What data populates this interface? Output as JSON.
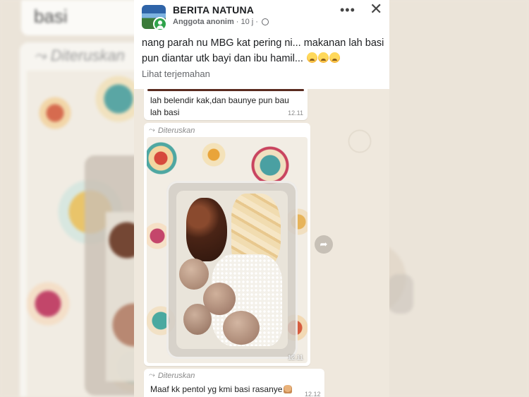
{
  "background": {
    "partial_text": "basi",
    "forward_label": "Diteruskan"
  },
  "post": {
    "page_name": "BERITA NATUNA",
    "author": "Anggota anonim",
    "time": "10 j",
    "text": "nang parah nu MBG kat pering ni... makanan lah basi pun diantar utk bayi dan ibu hamil...",
    "translate_link": "Lihat terjemahan",
    "more_icon": "more-icon",
    "close_icon": "close-icon"
  },
  "chat": {
    "messages": [
      {
        "text": "lah belendir kak,dan baunye pun bau lah basi",
        "time": "12.11"
      },
      {
        "forward_label": "Diteruskan",
        "type": "photo",
        "time": "12.11"
      },
      {
        "forward_label": "Diteruskan",
        "text": "Maaf kk pentol yg kmi basi rasanye",
        "time": "12.12"
      }
    ]
  }
}
